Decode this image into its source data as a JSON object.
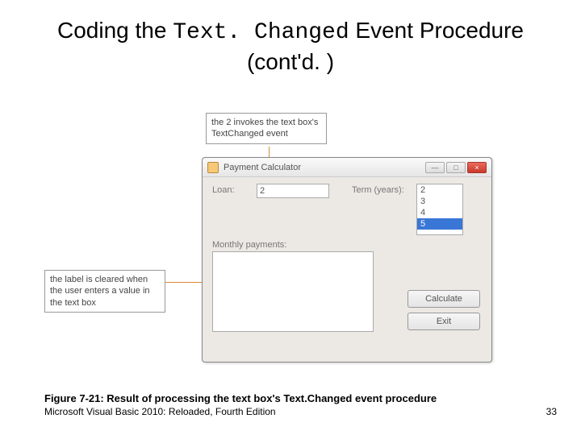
{
  "title": {
    "pre": "Coding the ",
    "mono": "Text. Changed",
    "post": " Event Procedure (cont'd. )"
  },
  "callouts": {
    "top": "the 2 invokes the text box's TextChanged event",
    "left": "the label is cleared when the user enters a value in the text box"
  },
  "window": {
    "title": "Payment Calculator",
    "loan_label": "Loan:",
    "loan_value": "2",
    "term_label": "Term (years):",
    "list_items": [
      "2",
      "3",
      "4",
      "5"
    ],
    "list_selected_index": 3,
    "monthly_label": "Monthly payments:",
    "calc_btn": "Calculate",
    "exit_btn": "Exit",
    "min_glyph": "—",
    "max_glyph": "□",
    "close_glyph": "×"
  },
  "caption": "Figure 7-21: Result of processing the text box's Text.Changed event procedure",
  "footer": "Microsoft Visual Basic 2010: Reloaded, Fourth Edition",
  "page": "33"
}
